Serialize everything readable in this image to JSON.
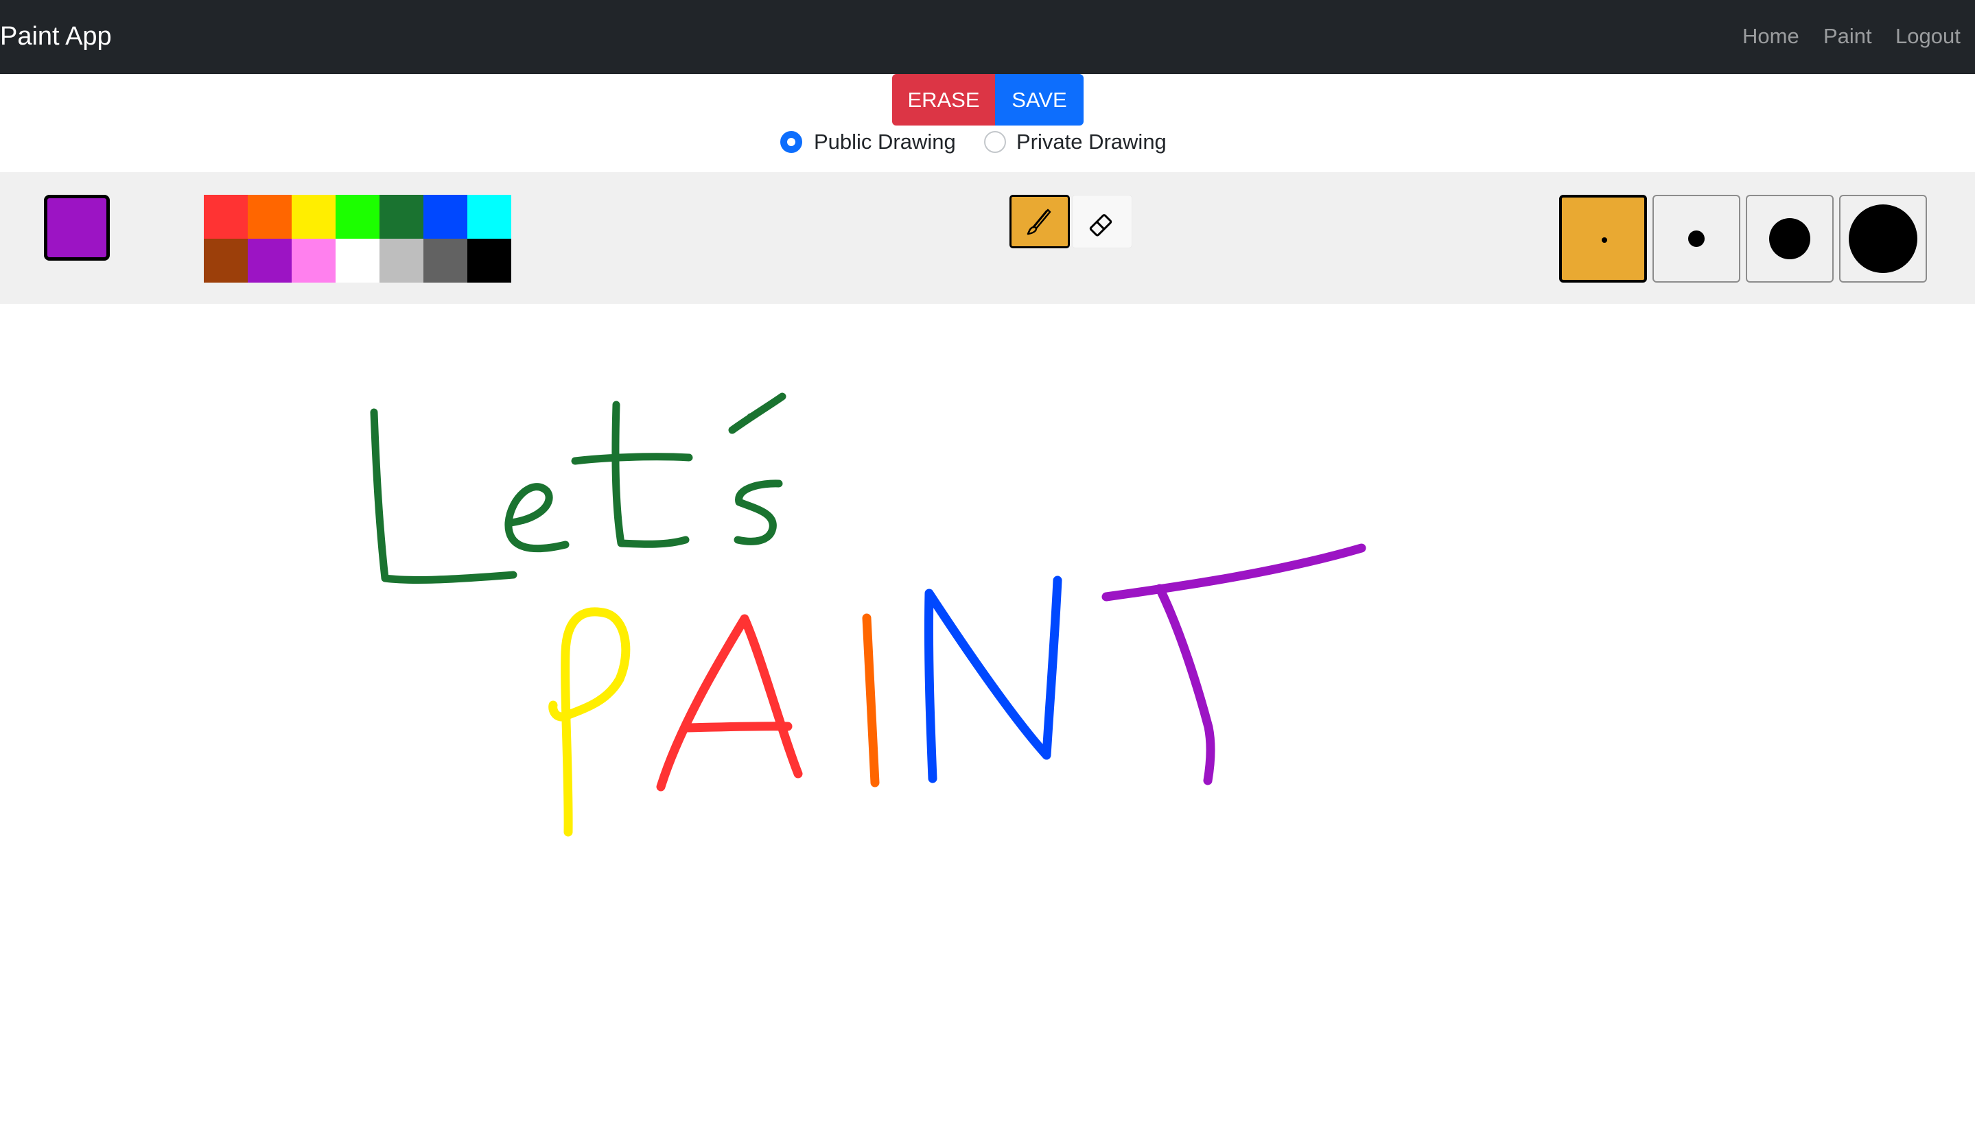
{
  "navbar": {
    "brand": "Paint App",
    "links": [
      "Home",
      "Paint",
      "Logout"
    ]
  },
  "actions": {
    "erase_label": "ERASE",
    "save_label": "SAVE"
  },
  "visibility": {
    "options": [
      "Public Drawing",
      "Private Drawing"
    ],
    "selected": "Public Drawing"
  },
  "toolbar": {
    "current_color": "#9c14c4",
    "palette": [
      "#ff3333",
      "#ff6600",
      "#ffee00",
      "#1cff00",
      "#1a7330",
      "#0048ff",
      "#00ffff",
      "#9c3f0a",
      "#9c14c4",
      "#ff80ee",
      "#ffffff",
      "#bebebe",
      "#626262",
      "#000000"
    ],
    "tools": [
      {
        "name": "brush",
        "icon": "brush-icon",
        "selected": true
      },
      {
        "name": "eraser",
        "icon": "eraser-icon",
        "selected": false
      }
    ],
    "brush_sizes": [
      "small",
      "medium",
      "large",
      "extra-large"
    ],
    "selected_brush_size": "small",
    "active_color": "#e9a932"
  },
  "canvas": {
    "handwritten_text": "Let's PAINT",
    "stroke_colors": {
      "lets": "#1a7330",
      "P": "#ffee00",
      "A": "#ff3333",
      "I": "#ff6600",
      "N": "#0048ff",
      "T": "#9c14c4"
    }
  }
}
